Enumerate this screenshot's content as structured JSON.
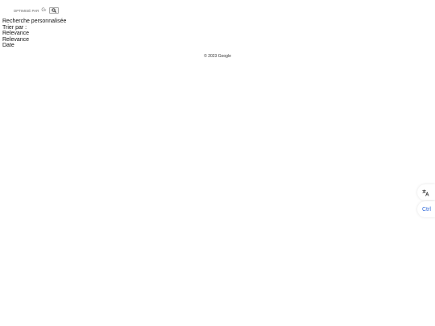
{
  "search": {
    "optimised_label": "OPTIMISÉ PAR",
    "brand_mark": "G"
  },
  "filters": {
    "title": "Recherche personnalisée",
    "sort_label": "Trier par :",
    "sort_selected": "Relevance",
    "options": [
      "Relevance",
      "Date"
    ]
  },
  "footer": {
    "copyright": "© 2023 Google"
  },
  "side_tools": {
    "translate_icon": "translate-icon",
    "ctrl_label": "Ctrl"
  },
  "colors": {
    "accent": "#2b66d9"
  }
}
